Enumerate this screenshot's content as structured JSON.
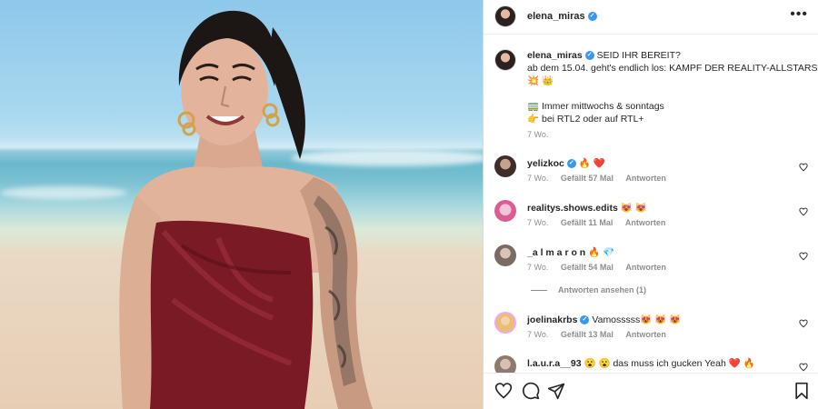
{
  "post": {
    "username": "elena_miras",
    "verified_badge": "✓",
    "more_label": "•••"
  },
  "caption": {
    "username": "elena_miras",
    "line1": "SEID IHR BEREIT?",
    "line2": "ab dem 15.04. geht's endlich los: KAMPF DER REALITY-ALLSTARS",
    "line3": "💥 👑",
    "line4": "🚃 Immer mittwochs & sonntags",
    "line5": "👉 bei RTL2 oder auf RTL+",
    "age": "7 Wo."
  },
  "comments": [
    {
      "username": "yelizkoc",
      "verified": true,
      "text": "🔥 ❤️",
      "age": "7 Wo.",
      "likes": "Gefällt 57 Mal",
      "reply": "Antworten"
    },
    {
      "username": "realitys.shows.edits",
      "verified": false,
      "text": "😻 😻",
      "age": "7 Wo.",
      "likes": "Gefällt 11 Mal",
      "reply": "Antworten"
    },
    {
      "username": "_a l m a r o n",
      "verified": false,
      "text": "🔥 💎",
      "age": "7 Wo.",
      "likes": "Gefällt 54 Mal",
      "reply": "Antworten"
    },
    {
      "username": "joelinakrbs",
      "verified": true,
      "text": "Vamosssss😻 😻 😻",
      "age": "7 Wo.",
      "likes": "Gefällt 13 Mal",
      "reply": "Antworten"
    },
    {
      "username": "l.a.u.r.a__93",
      "verified": false,
      "text": "😮 😮  das muss ich gucken Yeah ❤️ 🔥",
      "age": "",
      "likes": "",
      "reply": ""
    }
  ],
  "view_replies": "Antworten ansehen (1)",
  "icons": {
    "more": "more-options-icon",
    "like": "heart-icon",
    "comment": "comment-icon",
    "share": "share-icon",
    "save": "bookmark-icon",
    "verified": "verified-badge-icon"
  },
  "colors": {
    "verified": "#3897f0",
    "secondary_text": "#8e8e8e",
    "dress": "#7a1a25",
    "border": "#dbdbdb"
  }
}
